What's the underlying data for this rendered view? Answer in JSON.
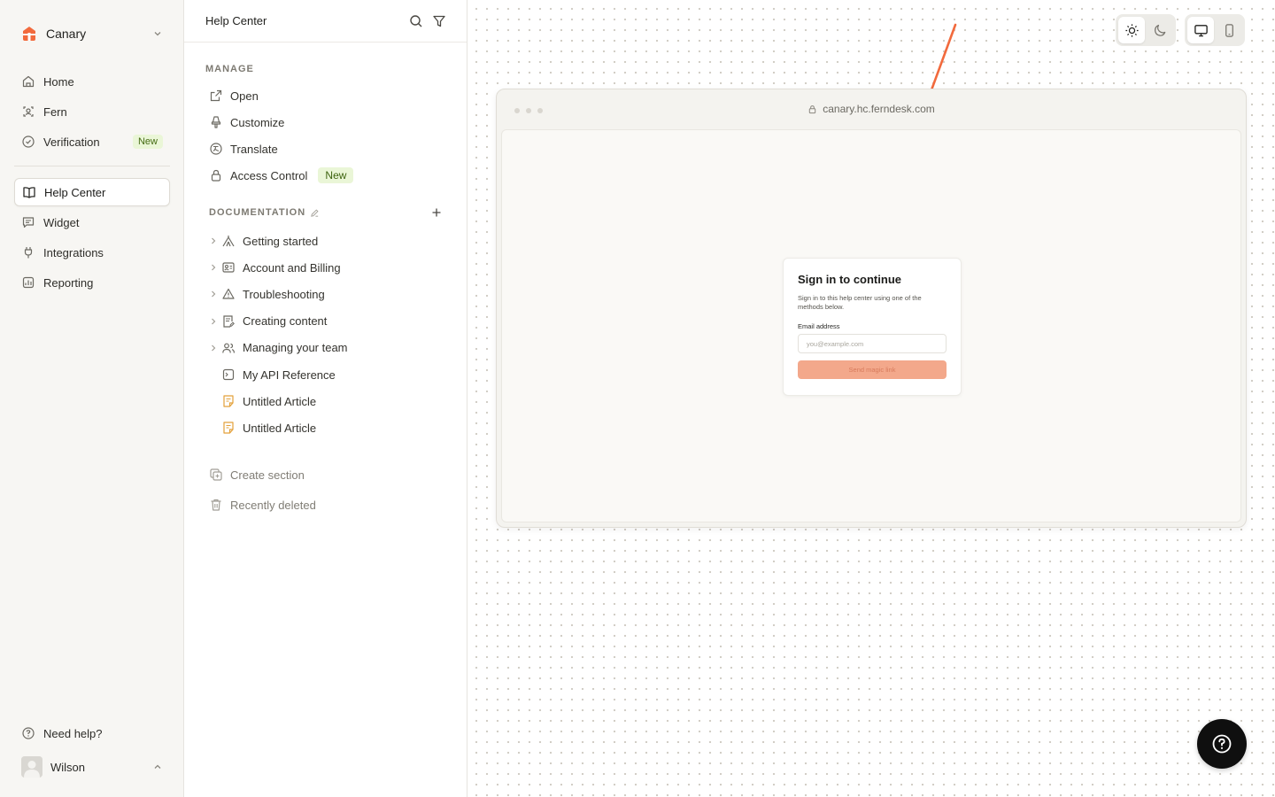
{
  "sidebar": {
    "workspace": "Canary",
    "nav": [
      {
        "label": "Home",
        "icon": "home-icon"
      },
      {
        "label": "Fern",
        "icon": "fern-bot-icon"
      },
      {
        "label": "Verification",
        "icon": "check-circle-icon",
        "badge": "New"
      }
    ],
    "nav2": [
      {
        "label": "Help Center",
        "icon": "book-open-icon",
        "active": true
      },
      {
        "label": "Widget",
        "icon": "chat-icon"
      },
      {
        "label": "Integrations",
        "icon": "plug-icon"
      },
      {
        "label": "Reporting",
        "icon": "chart-icon"
      }
    ],
    "help": "Need help?",
    "user": "Wilson"
  },
  "panel": {
    "title": "Help Center",
    "manage_label": "MANAGE",
    "manage": [
      {
        "label": "Open",
        "icon": "external-link-icon"
      },
      {
        "label": "Customize",
        "icon": "paint-icon"
      },
      {
        "label": "Translate",
        "icon": "translate-icon"
      },
      {
        "label": "Access Control",
        "icon": "lock-icon",
        "badge": "New"
      }
    ],
    "docs_label": "DOCUMENTATION",
    "docs": [
      {
        "label": "Getting started",
        "icon": "tent-icon",
        "expandable": true
      },
      {
        "label": "Account and Billing",
        "icon": "id-card-icon",
        "expandable": true
      },
      {
        "label": "Troubleshooting",
        "icon": "warning-icon",
        "expandable": true
      },
      {
        "label": "Creating content",
        "icon": "document-edit-icon",
        "expandable": true
      },
      {
        "label": "Managing your team",
        "icon": "users-icon",
        "expandable": true
      },
      {
        "label": "My API Reference",
        "icon": "terminal-icon",
        "expandable": false
      },
      {
        "label": "Untitled Article",
        "icon": "draft-article-icon",
        "expandable": false
      },
      {
        "label": "Untitled Article",
        "icon": "draft-article-icon",
        "expandable": false
      }
    ],
    "create_section": "Create section",
    "recently_deleted": "Recently deleted"
  },
  "preview": {
    "url": "canary.hc.ferndesk.com",
    "signin_title": "Sign in to continue",
    "signin_text": "Sign in to this help center using one of the methods below.",
    "email_label": "Email address",
    "email_placeholder": "you@example.com",
    "button": "Send magic link"
  },
  "colors": {
    "accent": "#f26a3d",
    "arrow": "#f26a3d",
    "badge_bg": "#eaf6d7",
    "draft_icon": "#e3a13a"
  }
}
